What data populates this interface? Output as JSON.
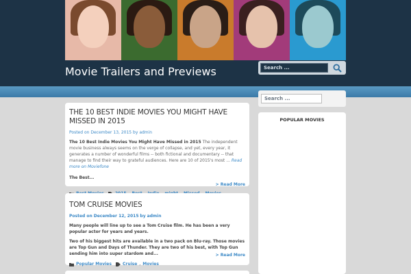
{
  "site": {
    "title": "Movie Trailers and Previews"
  },
  "header_search": {
    "placeholder": "Search ..."
  },
  "banner": {
    "panels": [
      {
        "name": "panel-deer-girl",
        "bg": "#e7b9a8",
        "hair": "#7a4a2e",
        "face": "#f4d0bd"
      },
      {
        "name": "panel-green-woman",
        "bg": "#3b6b2f",
        "hair": "#2b1a12",
        "face": "#8a5c3a"
      },
      {
        "name": "panel-dark-man",
        "bg": "#c97b2c",
        "hair": "#2a1d16",
        "face": "#c9a488"
      },
      {
        "name": "panel-curly-woman",
        "bg": "#a23b7a",
        "hair": "#3a2020",
        "face": "#e6c2ac"
      },
      {
        "name": "panel-masked-woman",
        "bg": "#2a9ad0",
        "hair": "#1d4a5a",
        "face": "#9bc9cf"
      }
    ]
  },
  "posts": [
    {
      "title": "THE 10 BEST INDIE MOVIES YOU MIGHT HAVE MISSED IN 2015",
      "meta_prefix": "Posted on",
      "date": "December 13, 2015",
      "by": "by",
      "author": "admin",
      "excerpt_bold": "The 10 Best Indie Movies You Might Have Missed in 2015",
      "excerpt": " The independent movie business always seems on the verge of collapse, and yet, every year, it generates a number of wonderful films -- both fictional and documentary -- that manage to find their way to grateful audiences. Here are 10 of 2015's most ... ",
      "excerpt_italic": "Read more on Moviefone",
      "excerpt2": "The Best...",
      "read_more": "> Read More",
      "category": "Best Movies",
      "tags": [
        "2015",
        "Best",
        "Indie",
        "might",
        "Missed",
        "Movies"
      ]
    },
    {
      "title": "TOM CRUISE MOVIES",
      "meta_prefix": "Posted on",
      "date": "December 12, 2015",
      "by": "by",
      "author": "admin",
      "excerpt": "Many people will line up to see a Tom Cruise film. He has been a very popular actor for years and years.",
      "excerpt2": "Two of his biggest hits are available in a two pack on Blu-ray. Those movies are Top Gun and Days of Thunder. They are two of his best, with Top Gun sending him into super stardom and...",
      "read_more": "> Read More",
      "category": "Popular Movies",
      "tags": [
        "Cruise",
        "Movies"
      ]
    }
  ],
  "sidebar": {
    "search_placeholder": "Search ...",
    "widget_title": "POPULAR MOVIES"
  }
}
